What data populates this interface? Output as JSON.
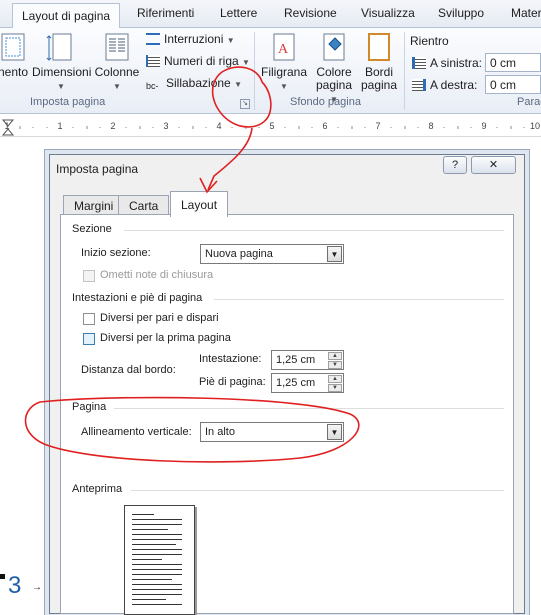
{
  "ribbon": {
    "tabs": [
      "Layout di pagina",
      "Riferimenti",
      "Lettere",
      "Revisione",
      "Visualizza",
      "Sviluppo",
      "Mater"
    ],
    "active_tab": "Layout di pagina",
    "imposta_pagina": {
      "margini_partial": "nento",
      "dimensioni": "Dimensioni",
      "colonne": "Colonne",
      "interruzioni": "Interruzioni",
      "numeri_di_riga": "Numeri di riga",
      "sillabazione": "Sillabazione",
      "title": "Imposta pagina"
    },
    "sfondo_pagina": {
      "filigrana": "Filigrana",
      "colore_pagina_1": "Colore",
      "colore_pagina_2": "pagina",
      "bordi_pagina_1": "Bordi",
      "bordi_pagina_2": "pagina",
      "title": "Sfondo pagina"
    },
    "paragrafo": {
      "rientro": "Rientro",
      "a_sinistra_label": "A sinistra:",
      "a_sinistra_value": "0 cm",
      "a_destra_label": "A destra:",
      "a_destra_value": "0 cm",
      "title_partial": "Parag"
    }
  },
  "ruler": {
    "numbers": [
      "1",
      "1",
      "2",
      "3",
      "4",
      "5",
      "6",
      "7",
      "8",
      "9",
      "10"
    ]
  },
  "dialog": {
    "title": "Imposta pagina",
    "help_label": "?",
    "close_label": "✕",
    "tabs": [
      "Margini",
      "Carta",
      "Layout"
    ],
    "active_tab": "Layout",
    "sezione": {
      "header": "Sezione",
      "inizio_sezione_label": "Inizio sezione:",
      "inizio_sezione_value": "Nuova pagina",
      "ometti_note": "Ometti note di chiusura"
    },
    "intestazioni": {
      "header": "Intestazioni e piè di pagina",
      "diversi_pari_dispari": "Diversi per pari e dispari",
      "diversi_prima_pagina": "Diversi per la prima pagina",
      "distanza_label": "Distanza dal bordo:",
      "intestazione_label": "Intestazione:",
      "intestazione_value": "1,25 cm",
      "pie_label": "Piè di pagina:",
      "pie_value": "1,25 cm"
    },
    "pagina": {
      "header": "Pagina",
      "allineamento_label": "Allineamento verticale:",
      "allineamento_value": "In alto"
    },
    "anteprima": {
      "header": "Anteprima"
    }
  },
  "document": {
    "list_number": "3"
  },
  "colors": {
    "annotation": "#e02020",
    "accent": "#1f5ea8"
  }
}
